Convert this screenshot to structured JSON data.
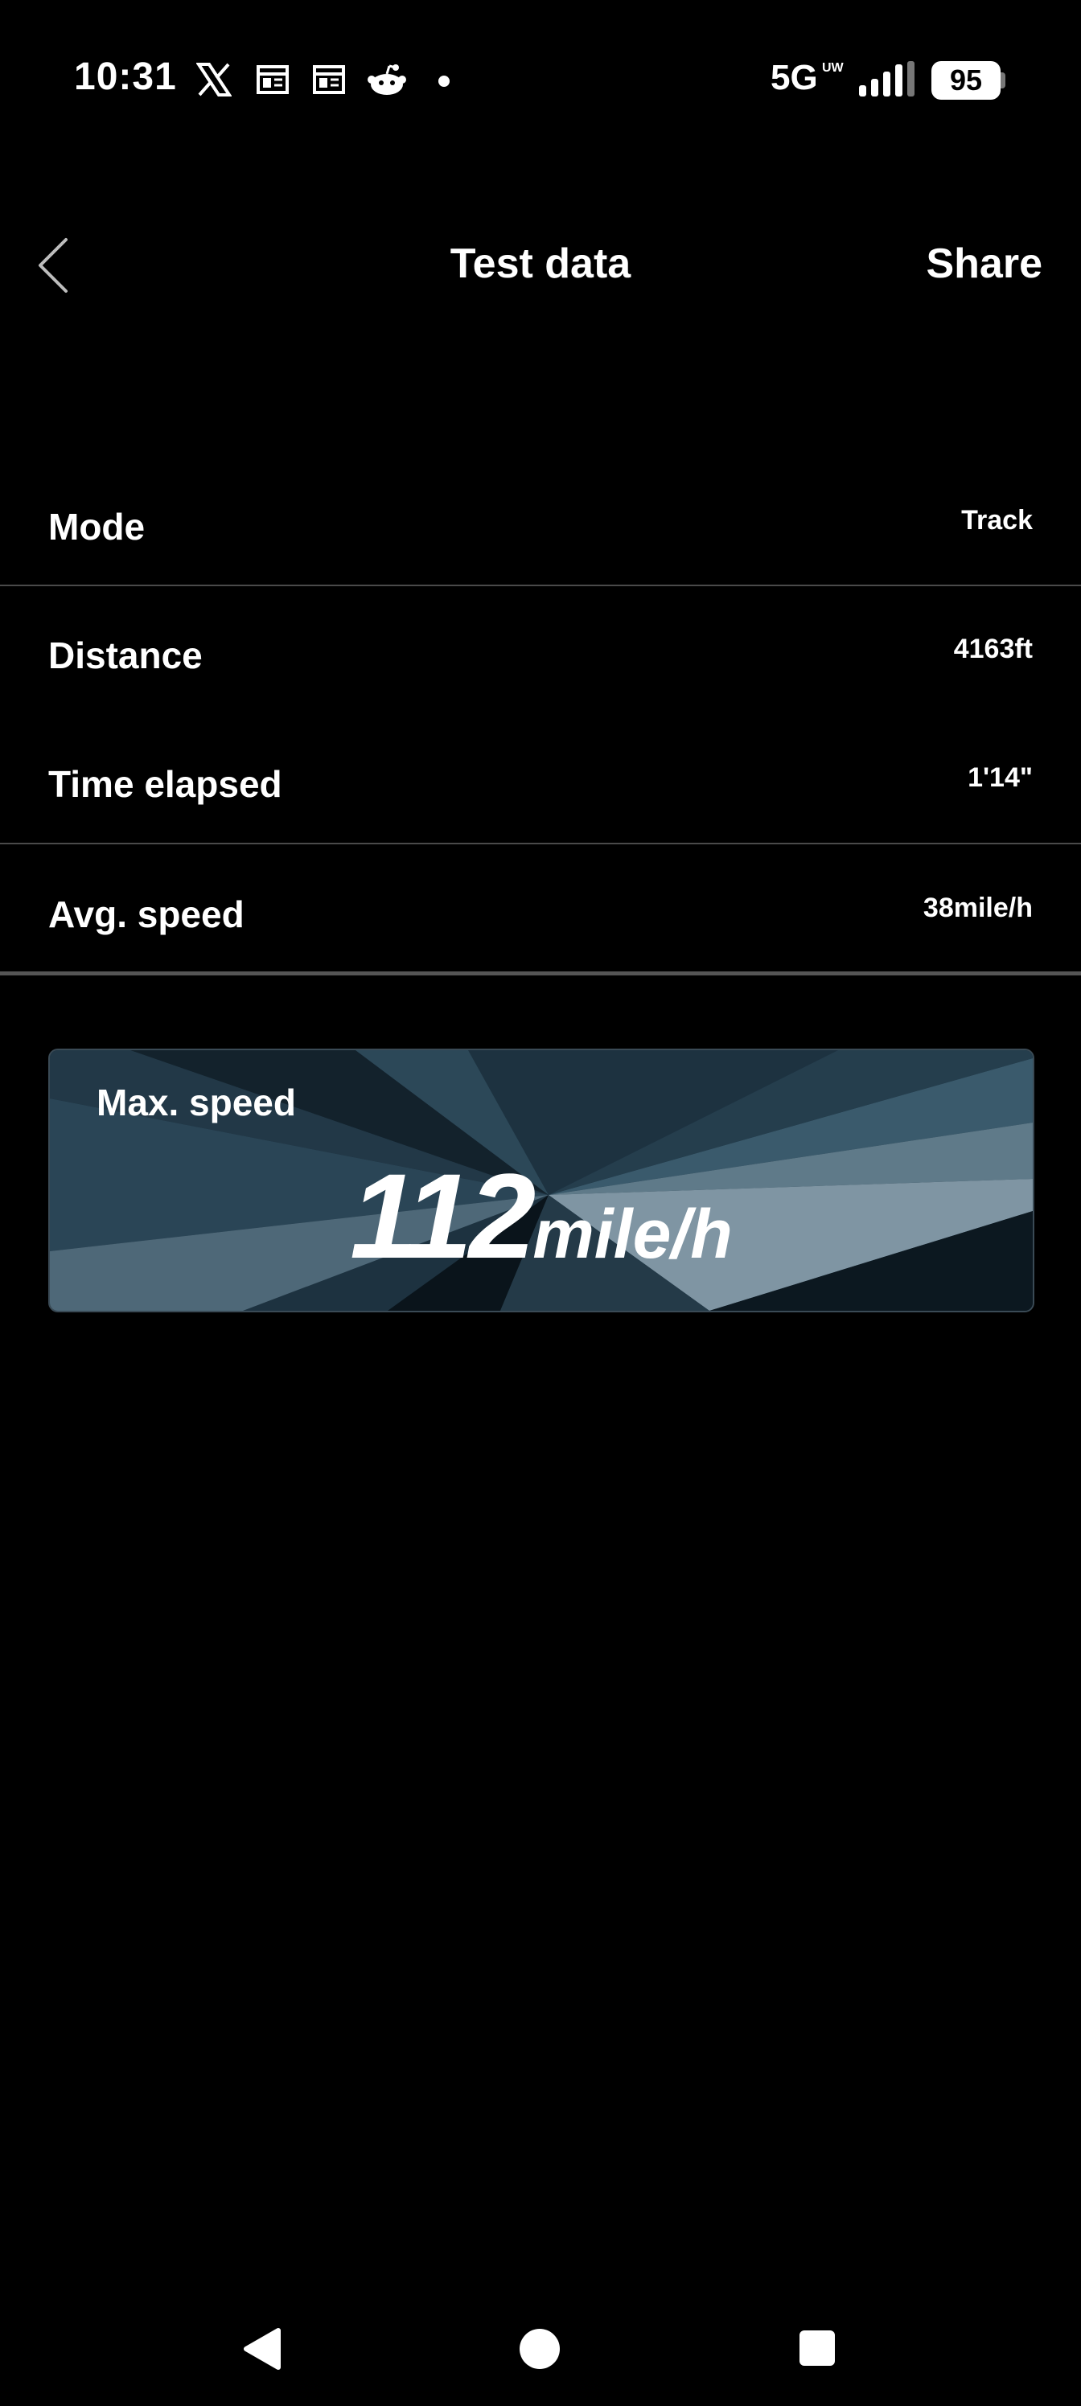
{
  "status_bar": {
    "time": "10:31",
    "network": "5G",
    "network_sub": "UW",
    "battery": "95",
    "icons": [
      "x-icon",
      "news-icon",
      "news-icon",
      "reddit-icon",
      "dot-icon",
      "signal-icon",
      "battery-icon"
    ]
  },
  "header": {
    "title": "Test data",
    "share_label": "Share",
    "back_icon": "chevron-left-icon"
  },
  "rows": [
    {
      "label": "Mode",
      "value": "Track"
    },
    {
      "label": "Distance",
      "value": "4163ft"
    },
    {
      "label": "Time elapsed",
      "value": "1'14\""
    },
    {
      "label": "Avg. speed",
      "value": "38mile/h"
    }
  ],
  "max_speed": {
    "label": "Max. speed",
    "value": "112",
    "unit": "mile/h"
  },
  "nav_bar": {
    "icons": [
      "nav-back-icon",
      "nav-home-icon",
      "nav-recents-icon"
    ]
  },
  "colors": {
    "background": "#000000",
    "text": "#ffffff",
    "divider": "#4a4a4a",
    "card_bg": "#1c2f3b"
  }
}
